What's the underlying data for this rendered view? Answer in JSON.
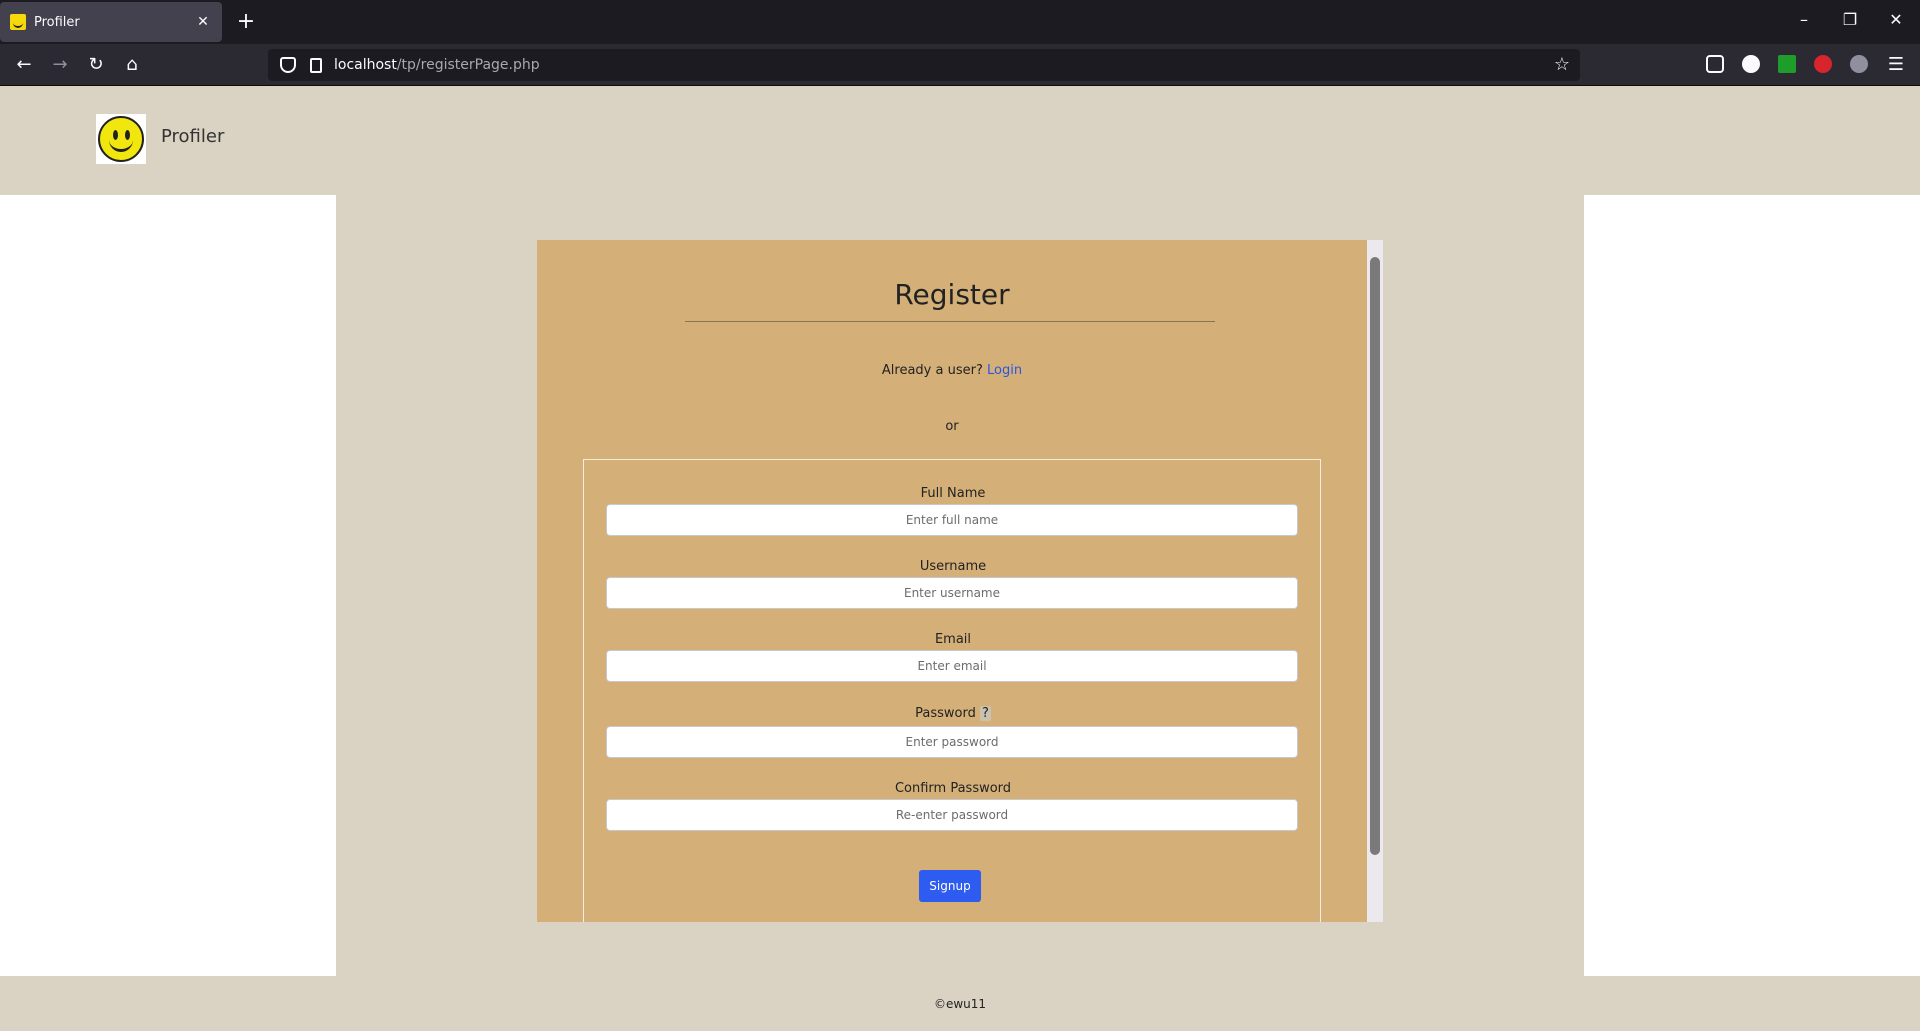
{
  "browser": {
    "tab_title": "Profiler",
    "tab_close": "✕",
    "new_tab": "+",
    "url_host": "localhost",
    "url_path": "/tp/registerPage.php"
  },
  "header": {
    "brand": "Profiler"
  },
  "register": {
    "title": "Register",
    "already_text": "Already a user?",
    "login_link": "Login",
    "or_text": "or"
  },
  "form": {
    "full_name_label": "Full Name",
    "full_name_placeholder": "Enter full name",
    "username_label": "Username",
    "username_placeholder": "Enter username",
    "email_label": "Email",
    "email_placeholder": "Enter email",
    "password_label": "Password",
    "password_help": "?",
    "password_placeholder": "Enter password",
    "confirm_label": "Confirm Password",
    "confirm_placeholder": "Re-enter password",
    "signup_label": "Signup"
  },
  "footer": {
    "copyright": "©ewu11"
  },
  "colors": {
    "page_bg": "#dad2c2",
    "card_bg": "#d4af78",
    "accent": "#2f5cf0",
    "link": "#2c56e0"
  }
}
